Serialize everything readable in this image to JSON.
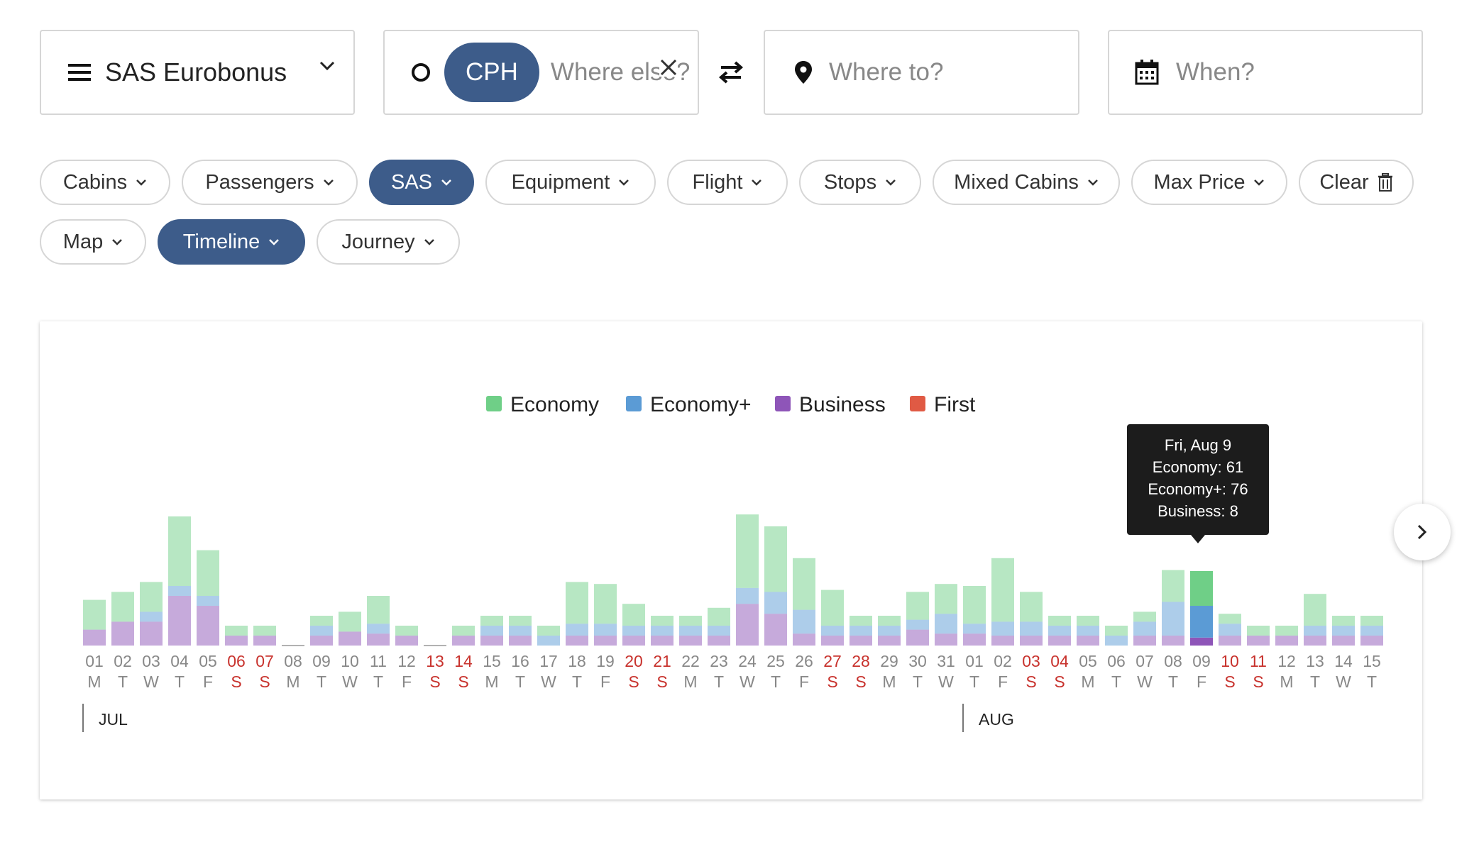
{
  "search": {
    "program": "SAS Eurobonus",
    "origin_code": "CPH",
    "origin_placeholder": "Where else?",
    "destination_placeholder": "Where to?",
    "date_placeholder": "When?"
  },
  "filters": [
    {
      "label": "Cabins",
      "active": false
    },
    {
      "label": "Passengers",
      "active": false
    },
    {
      "label": "SAS",
      "active": true
    },
    {
      "label": "Equipment",
      "active": false
    },
    {
      "label": "Flight",
      "active": false
    },
    {
      "label": "Stops",
      "active": false
    },
    {
      "label": "Mixed Cabins",
      "active": false
    },
    {
      "label": "Max Price",
      "active": false
    },
    {
      "label": "Clear",
      "active": false
    },
    {
      "label": "Map",
      "active": false
    },
    {
      "label": "Timeline",
      "active": true
    },
    {
      "label": "Journey",
      "active": false
    }
  ],
  "tooltip": {
    "title": "Fri, Aug 9",
    "economy": "Economy: 61",
    "economy_plus": "Economy+: 76",
    "business": "Business: 8"
  },
  "chart_data": {
    "type": "bar",
    "stacked": true,
    "legend_position": "top-center",
    "colors": {
      "Economy": "#6fcf87",
      "Economy+": "#5b9bd5",
      "Business": "#8e55b8",
      "First": "#e05a44",
      "weekend": "#c8322d",
      "weekday": "#888888"
    },
    "months": [
      "JUL",
      "AUG"
    ],
    "days": [
      "01",
      "02",
      "03",
      "04",
      "05",
      "06",
      "07",
      "08",
      "09",
      "10",
      "11",
      "12",
      "13",
      "14",
      "15",
      "16",
      "17",
      "18",
      "19",
      "20",
      "21",
      "22",
      "23",
      "24",
      "25",
      "26",
      "27",
      "28",
      "29",
      "30",
      "31",
      "01",
      "02",
      "03",
      "04",
      "05",
      "06",
      "07",
      "08",
      "09",
      "10",
      "11",
      "12",
      "13",
      "14",
      "15"
    ],
    "weekdays": [
      "M",
      "T",
      "W",
      "T",
      "F",
      "S",
      "S",
      "M",
      "T",
      "W",
      "T",
      "F",
      "S",
      "S",
      "M",
      "T",
      "W",
      "T",
      "F",
      "S",
      "S",
      "M",
      "T",
      "W",
      "T",
      "F",
      "S",
      "S",
      "M",
      "T",
      "W",
      "T",
      "F",
      "S",
      "S",
      "M",
      "T",
      "W",
      "T",
      "F",
      "S",
      "S",
      "M",
      "T",
      "W",
      "T"
    ],
    "weekend": [
      false,
      false,
      false,
      false,
      false,
      true,
      true,
      false,
      false,
      false,
      false,
      false,
      true,
      true,
      false,
      false,
      false,
      false,
      false,
      true,
      true,
      false,
      false,
      false,
      false,
      false,
      true,
      true,
      false,
      false,
      false,
      false,
      false,
      true,
      true,
      false,
      false,
      false,
      false,
      false,
      true,
      true,
      false,
      false,
      false,
      false
    ],
    "highlight_index": 39,
    "series": [
      {
        "name": "Economy",
        "values": [
          30,
          30,
          30,
          70,
          46,
          10,
          10,
          0,
          10,
          20,
          28,
          10,
          0,
          10,
          10,
          10,
          10,
          42,
          40,
          22,
          10,
          10,
          18,
          74,
          66,
          52,
          36,
          10,
          10,
          28,
          30,
          38,
          64,
          30,
          10,
          10,
          10,
          10,
          32,
          35,
          10,
          10,
          10,
          32,
          10,
          10
        ]
      },
      {
        "name": "Economy+",
        "values": [
          0,
          0,
          10,
          10,
          10,
          0,
          0,
          0,
          10,
          0,
          10,
          0,
          0,
          0,
          10,
          10,
          10,
          12,
          12,
          10,
          10,
          10,
          10,
          16,
          22,
          24,
          10,
          10,
          10,
          10,
          20,
          10,
          14,
          14,
          10,
          10,
          10,
          14,
          34,
          32,
          12,
          0,
          0,
          10,
          10,
          10
        ]
      },
      {
        "name": "Business",
        "values": [
          16,
          24,
          24,
          50,
          40,
          10,
          10,
          0,
          10,
          14,
          12,
          10,
          0,
          10,
          10,
          10,
          0,
          10,
          10,
          10,
          10,
          10,
          10,
          42,
          32,
          12,
          10,
          10,
          10,
          16,
          12,
          12,
          10,
          10,
          10,
          10,
          0,
          10,
          10,
          8,
          10,
          10,
          10,
          10,
          10,
          10
        ]
      },
      {
        "name": "First",
        "values": [
          0,
          0,
          0,
          0,
          0,
          0,
          0,
          0,
          0,
          0,
          0,
          0,
          0,
          0,
          0,
          0,
          0,
          0,
          0,
          0,
          0,
          0,
          0,
          0,
          0,
          0,
          0,
          0,
          0,
          0,
          0,
          0,
          0,
          0,
          0,
          0,
          0,
          0,
          0,
          0,
          0,
          0,
          0,
          0,
          0,
          0
        ]
      }
    ],
    "ylim": [
      0,
      140
    ]
  }
}
